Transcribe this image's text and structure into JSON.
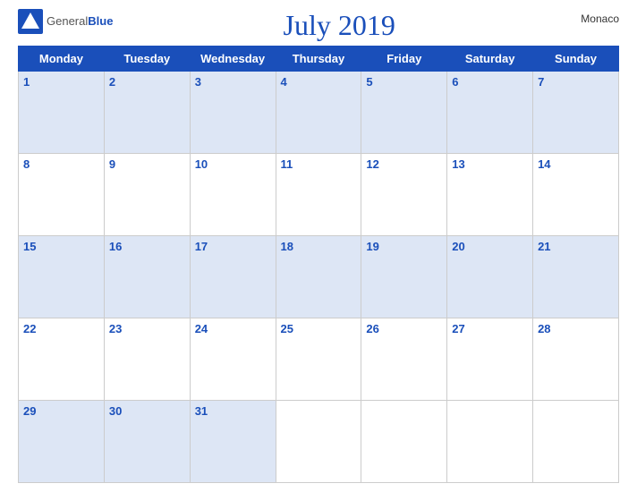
{
  "header": {
    "logo_general": "General",
    "logo_blue": "Blue",
    "title": "July 2019",
    "country": "Monaco"
  },
  "days": [
    "Monday",
    "Tuesday",
    "Wednesday",
    "Thursday",
    "Friday",
    "Saturday",
    "Sunday"
  ],
  "weeks": [
    [
      "1",
      "2",
      "3",
      "4",
      "5",
      "6",
      "7"
    ],
    [
      "8",
      "9",
      "10",
      "11",
      "12",
      "13",
      "14"
    ],
    [
      "15",
      "16",
      "17",
      "18",
      "19",
      "20",
      "21"
    ],
    [
      "22",
      "23",
      "24",
      "25",
      "26",
      "27",
      "28"
    ],
    [
      "29",
      "30",
      "31",
      "",
      "",
      "",
      ""
    ]
  ]
}
